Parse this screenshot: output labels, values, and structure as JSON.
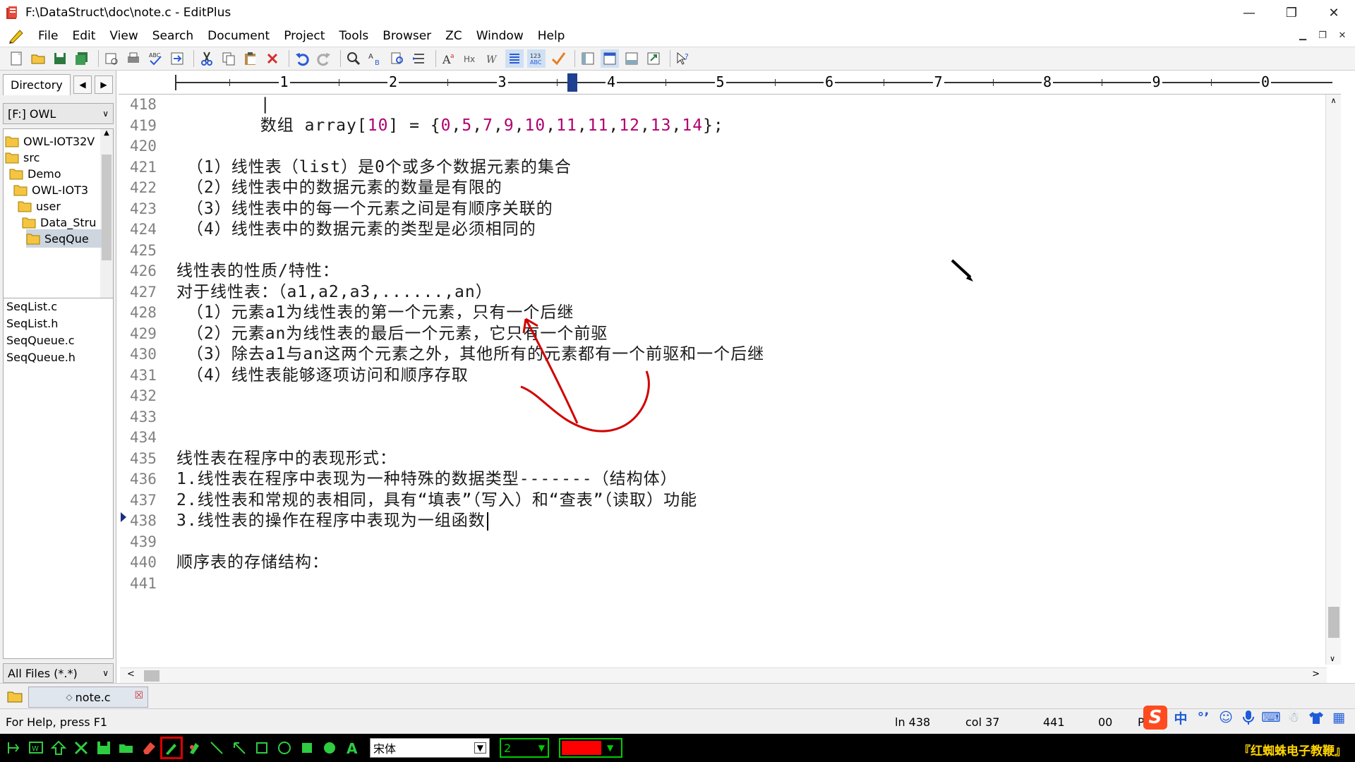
{
  "window": {
    "title": "F:\\DataStruct\\doc\\note.c - EditPlus",
    "controls": [
      "—",
      "❐",
      "✕"
    ]
  },
  "menu": [
    "File",
    "Edit",
    "View",
    "Search",
    "Document",
    "Project",
    "Tools",
    "Browser",
    "ZC",
    "Window",
    "Help"
  ],
  "sidebar": {
    "tab_label": "Directory",
    "drive": "[F:] OWL",
    "tree": [
      {
        "label": "OWL-IOT32V",
        "indent": 0
      },
      {
        "label": "src",
        "indent": 0
      },
      {
        "label": "Demo",
        "indent": 1
      },
      {
        "label": "OWL-IOT3",
        "indent": 2
      },
      {
        "label": "user",
        "indent": 3
      },
      {
        "label": "Data_Stru",
        "indent": 4
      },
      {
        "label": "SeqQue",
        "indent": 5,
        "selected": true
      }
    ],
    "files": [
      "SeqList.c",
      "SeqList.h",
      "SeqQueue.c",
      "SeqQueue.h"
    ],
    "filter": "All Files (*.*)"
  },
  "ruler": {
    "labels": [
      "1",
      "2",
      "3",
      "4",
      "5",
      "6",
      "7",
      "8",
      "9",
      "0"
    ]
  },
  "editor": {
    "lines": [
      {
        "n": "418",
        "text": "        |"
      },
      {
        "n": "419",
        "text": "        数组 array[10] = {0,5,7,9,10,11,11,12,13,14};"
      },
      {
        "n": "420",
        "text": ""
      },
      {
        "n": "421",
        "text": " （1）线性表（list）是0个或多个数据元素的集合"
      },
      {
        "n": "422",
        "text": " （2）线性表中的数据元素的数量是有限的"
      },
      {
        "n": "423",
        "text": " （3）线性表中的每一个元素之间是有顺序关联的"
      },
      {
        "n": "424",
        "text": " （4）线性表中的数据元素的类型是必须相同的"
      },
      {
        "n": "425",
        "text": ""
      },
      {
        "n": "426",
        "text": "线性表的性质/特性："
      },
      {
        "n": "427",
        "text": "对于线性表：（a1,a2,a3,......,an）"
      },
      {
        "n": "428",
        "text": " （1）元素a1为线性表的第一个元素，只有一个后继"
      },
      {
        "n": "429",
        "text": " （2）元素an为线性表的最后一个元素，它只有一个前驱"
      },
      {
        "n": "430",
        "text": " （3）除去a1与an这两个元素之外，其他所有的元素都有一个前驱和一个后继"
      },
      {
        "n": "431",
        "text": " （4）线性表能够逐项访问和顺序存取"
      },
      {
        "n": "432",
        "text": ""
      },
      {
        "n": "433",
        "text": ""
      },
      {
        "n": "434",
        "text": ""
      },
      {
        "n": "435",
        "text": "线性表在程序中的表现形式："
      },
      {
        "n": "436",
        "text": "1.线性表在程序中表现为一种特殊的数据类型-------（结构体）"
      },
      {
        "n": "437",
        "text": "2.线性表和常规的表相同，具有“填表”（写入）和“查表”（读取）功能"
      },
      {
        "n": "438",
        "text": "3.线性表的操作在程序中表现为一组函数",
        "current": true
      },
      {
        "n": "439",
        "text": ""
      },
      {
        "n": "440",
        "text": "顺序表的存储结构："
      },
      {
        "n": "441",
        "text": ""
      }
    ]
  },
  "tabs": [
    {
      "label": "note.c",
      "active": true
    }
  ],
  "status": {
    "help": "For Help, press F1",
    "ln": "ln 438",
    "col": "col 37",
    "lines": "441",
    "mode": "00",
    "enc": "PC"
  },
  "ime": {
    "brand": "S",
    "items": [
      "中",
      "°’",
      "☺",
      "🎤",
      "⌨",
      "☃",
      "⬆",
      "▦"
    ]
  },
  "annobar": {
    "font": "宋体",
    "size": "2",
    "color": "#ff0000",
    "brand": "『红蜘蛛电子教鞭』"
  },
  "colors": {
    "accent": "#1f3f8f",
    "number": "#b00070",
    "annotation": "#d00000"
  }
}
